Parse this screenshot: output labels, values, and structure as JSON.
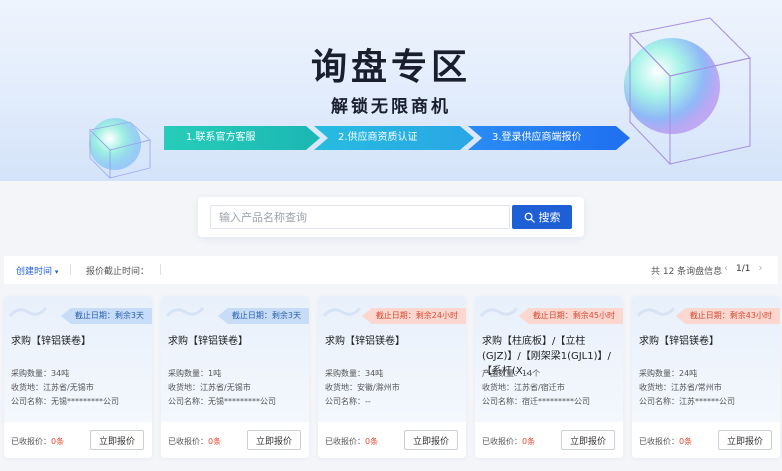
{
  "banner": {
    "title": "询盘专区",
    "subtitle": "解锁无限商机",
    "steps": [
      "1.联系官方客服",
      "2.供应商资质认证",
      "3.登录供应商端报价"
    ]
  },
  "search": {
    "placeholder": "输入产品名称查询",
    "button_label": "搜索",
    "value": ""
  },
  "sortbar": {
    "sort_created": "创建时间",
    "sort_deadline": "报价截止时间：",
    "total": "共 12 条询盘信息",
    "page": "1/1"
  },
  "cards": [
    {
      "badge": "截止日期：剩余3天",
      "badge_style": "blue",
      "title": "求购【锌铝镁卷】",
      "info": [
        {
          "label": "采购数量：",
          "value": "34吨"
        },
        {
          "label": "收货地：",
          "value": "江苏省/无锡市"
        },
        {
          "label": "公司名称：",
          "value": "无锡*********公司"
        }
      ],
      "quoted_label": "已收报价：",
      "quoted_count": "0条",
      "button": "立即报价"
    },
    {
      "badge": "截止日期：剩余3天",
      "badge_style": "blue",
      "title": "求购【锌铝镁卷】",
      "info": [
        {
          "label": "采购数量：",
          "value": "1吨"
        },
        {
          "label": "收货地：",
          "value": "江苏省/无锡市"
        },
        {
          "label": "公司名称：",
          "value": "无锡*********公司"
        }
      ],
      "quoted_label": "已收报价：",
      "quoted_count": "0条",
      "button": "立即报价"
    },
    {
      "badge": "截止日期：剩余24小时",
      "badge_style": "red",
      "title": "求购【锌铝镁卷】",
      "info": [
        {
          "label": "采购数量：",
          "value": "34吨"
        },
        {
          "label": "收货地：",
          "value": "安徽/滁州市"
        },
        {
          "label": "公司名称：",
          "value": "--"
        }
      ],
      "quoted_label": "已收报价：",
      "quoted_count": "0条",
      "button": "立即报价"
    },
    {
      "badge": "截止日期：剩余45小时",
      "badge_style": "red",
      "title": "求购【柱底板】/【立柱(GJZ)】/【刚架梁1(GJL1)】/【系杆(X...",
      "info": [
        {
          "label": "产品数量：",
          "value": "14个"
        },
        {
          "label": "收货地：",
          "value": "江苏省/宿迁市"
        },
        {
          "label": "公司名称：",
          "value": "宿迁*********公司"
        }
      ],
      "quoted_label": "已收报价：",
      "quoted_count": "0条",
      "button": "立即报价"
    },
    {
      "badge": "截止日期：剩余43小时",
      "badge_style": "red",
      "title": "求购【锌铝镁卷】",
      "info": [
        {
          "label": "采购数量：",
          "value": "24吨"
        },
        {
          "label": "收货地：",
          "value": "江苏省/常州市"
        },
        {
          "label": "公司名称：",
          "value": "江苏******公司"
        }
      ],
      "quoted_label": "已收报价：",
      "quoted_count": "0条",
      "button": "立即报价"
    }
  ]
}
